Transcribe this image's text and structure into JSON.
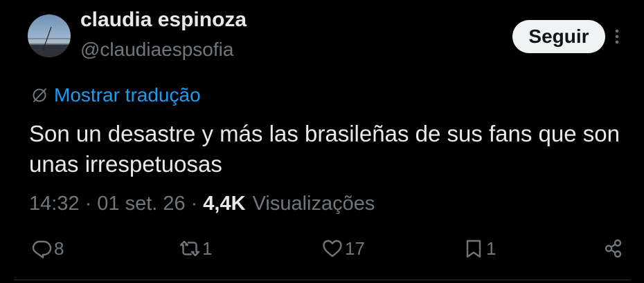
{
  "author": {
    "display_name": "claudia espinoza",
    "handle": "@claudiaespsofia"
  },
  "follow_label": "Seguir",
  "translate_label": "Mostrar tradução",
  "tweet": {
    "text": "Son un desastre y más las brasileñas de sus fans que son unas irrespetuosas",
    "time": "14:32",
    "date": "01 set. 26",
    "views_count": "4,4K",
    "views_label": "Visualizações",
    "separator": "·"
  },
  "actions": {
    "replies": "8",
    "reposts": "1",
    "likes": "17",
    "bookmarks": "1"
  },
  "icons": {
    "avatar": "beach-photo-avatar",
    "more": "more-vertical-icon",
    "translate": "globe-slash-icon",
    "reply": "reply-icon",
    "repost": "repost-icon",
    "like": "heart-icon",
    "bookmark": "bookmark-icon",
    "share": "share-icon"
  },
  "colors": {
    "background": "#000000",
    "text_primary": "#e7e9ea",
    "text_secondary": "#71767b",
    "link": "#1d9bf0",
    "button_bg": "#eff3f4",
    "button_text": "#0f1419"
  }
}
